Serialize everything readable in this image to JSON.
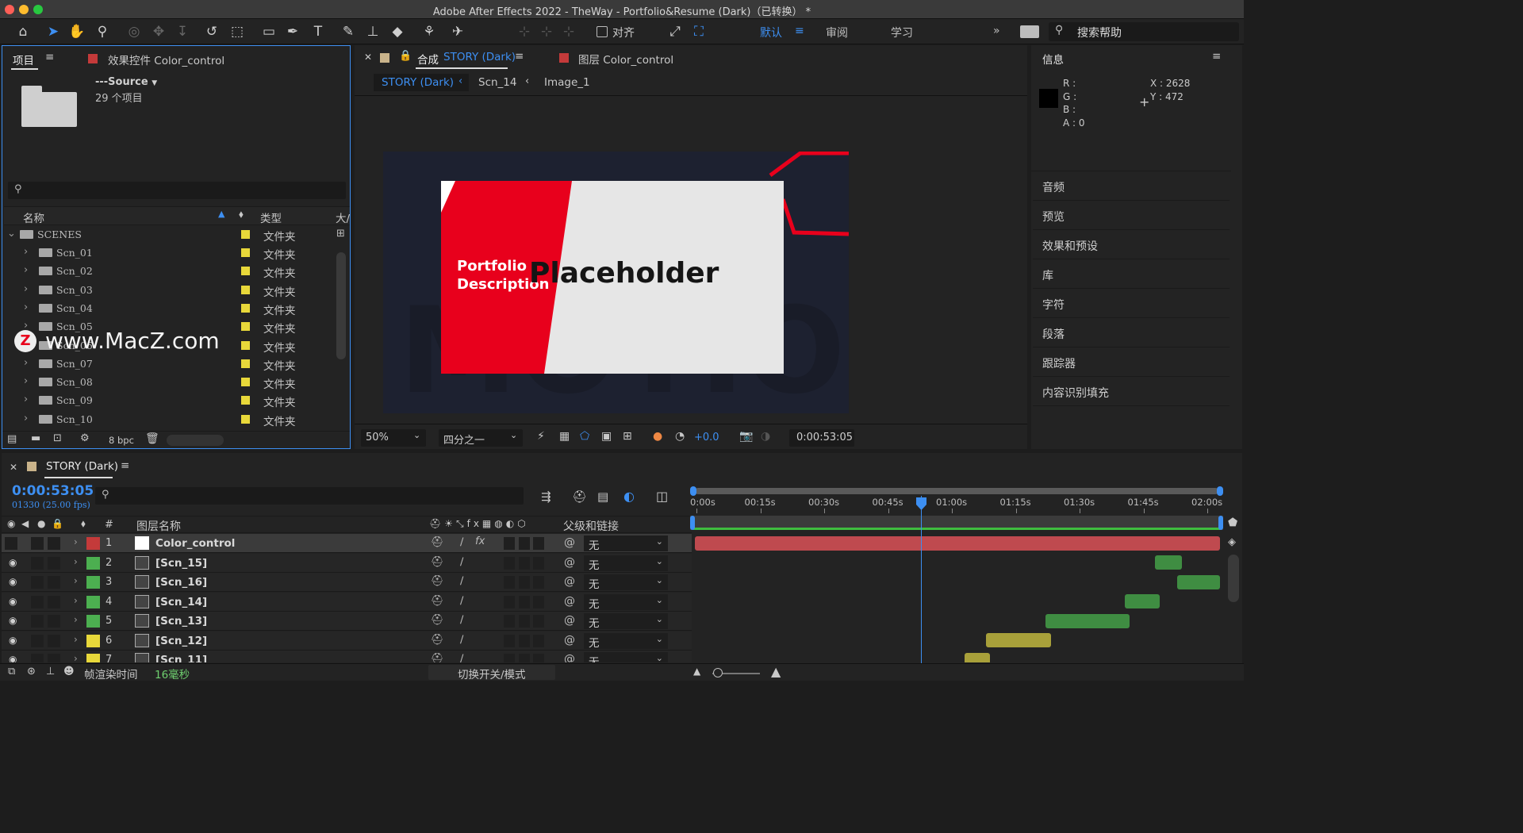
{
  "window": {
    "title": "Adobe After Effects 2022 - TheWay - Portfolio&Resume (Dark)（已转换） *"
  },
  "toolbar": {
    "snap_label": "对齐",
    "workspaces": [
      "默认",
      "审阅",
      "学习"
    ],
    "help_placeholder": "搜索帮助"
  },
  "project_panel": {
    "tab_project": "项目",
    "tab_effects": "效果控件 Color_control",
    "source_name": "---Source",
    "item_count": "29 个项目",
    "col_name": "名称",
    "col_type": "类型",
    "col_size": "大/",
    "root": {
      "name": "SCENES",
      "type": "文件夹"
    },
    "rows": [
      {
        "name": "Scn_01",
        "type": "文件夹"
      },
      {
        "name": "Scn_02",
        "type": "文件夹"
      },
      {
        "name": "Scn_03",
        "type": "文件夹"
      },
      {
        "name": "Scn_04",
        "type": "文件夹"
      },
      {
        "name": "Scn_05",
        "type": "文件夹"
      },
      {
        "name": "Scn_06",
        "type": "文件夹"
      },
      {
        "name": "Scn_07",
        "type": "文件夹"
      },
      {
        "name": "Scn_08",
        "type": "文件夹"
      },
      {
        "name": "Scn_09",
        "type": "文件夹"
      },
      {
        "name": "Scn_10",
        "type": "文件夹"
      }
    ],
    "bpc": "8 bpc",
    "watermark": "www.MacZ.com"
  },
  "comp_panel": {
    "tab_prefix": "合成",
    "tab_comp": "STORY (Dark)",
    "tab_layer": "图层 Color_control",
    "breadcrumbs": [
      "STORY (Dark)",
      "Scn_14",
      "Image_1"
    ],
    "preview_text1": "Portfolio",
    "preview_text2": "Description",
    "preview_text3": "Placeholder",
    "zoom": "50%",
    "resolution": "四分之一",
    "exposure": "+0.0",
    "timecode": "0:00:53:05"
  },
  "info_panel": {
    "title": "信息",
    "r_label": "R :",
    "g_label": "G :",
    "b_label": "B :",
    "a_label": "A :",
    "a_value": "0",
    "x_label": "X : 2628",
    "y_label": "Y : 472",
    "sections": [
      "音频",
      "预览",
      "效果和预设",
      "库",
      "字符",
      "段落",
      "跟踪器",
      "内容识别填充"
    ]
  },
  "timeline": {
    "tab": "STORY (Dark)",
    "timecode": "0:00:53:05",
    "frame_info": "01330 (25.00 fps)",
    "col_hash": "#",
    "col_layer_name": "图层名称",
    "col_parent": "父级和链接",
    "ruler": [
      "0:00s",
      "00:15s",
      "00:30s",
      "00:45s",
      "01:00s",
      "01:15s",
      "01:30s",
      "01:45s",
      "02:00s"
    ],
    "layers": [
      {
        "num": "1",
        "name": "Color_control",
        "parent": "无",
        "color": "#c43a3a"
      },
      {
        "num": "2",
        "name": "[Scn_15]",
        "parent": "无",
        "color": "#4caf50"
      },
      {
        "num": "3",
        "name": "[Scn_16]",
        "parent": "无",
        "color": "#4caf50"
      },
      {
        "num": "4",
        "name": "[Scn_14]",
        "parent": "无",
        "color": "#4caf50"
      },
      {
        "num": "5",
        "name": "[Scn_13]",
        "parent": "无",
        "color": "#4caf50"
      },
      {
        "num": "6",
        "name": "[Scn_12]",
        "parent": "无",
        "color": "#e8d83a"
      },
      {
        "num": "7",
        "name": "[Scn_11]",
        "parent": "无",
        "color": "#e8d83a"
      }
    ],
    "render_label": "帧渲染时间",
    "render_value": "16毫秒",
    "toggle_label": "切换开关/模式"
  },
  "colors": {
    "accent": "#3d8ff2",
    "red": "#e8001c"
  }
}
